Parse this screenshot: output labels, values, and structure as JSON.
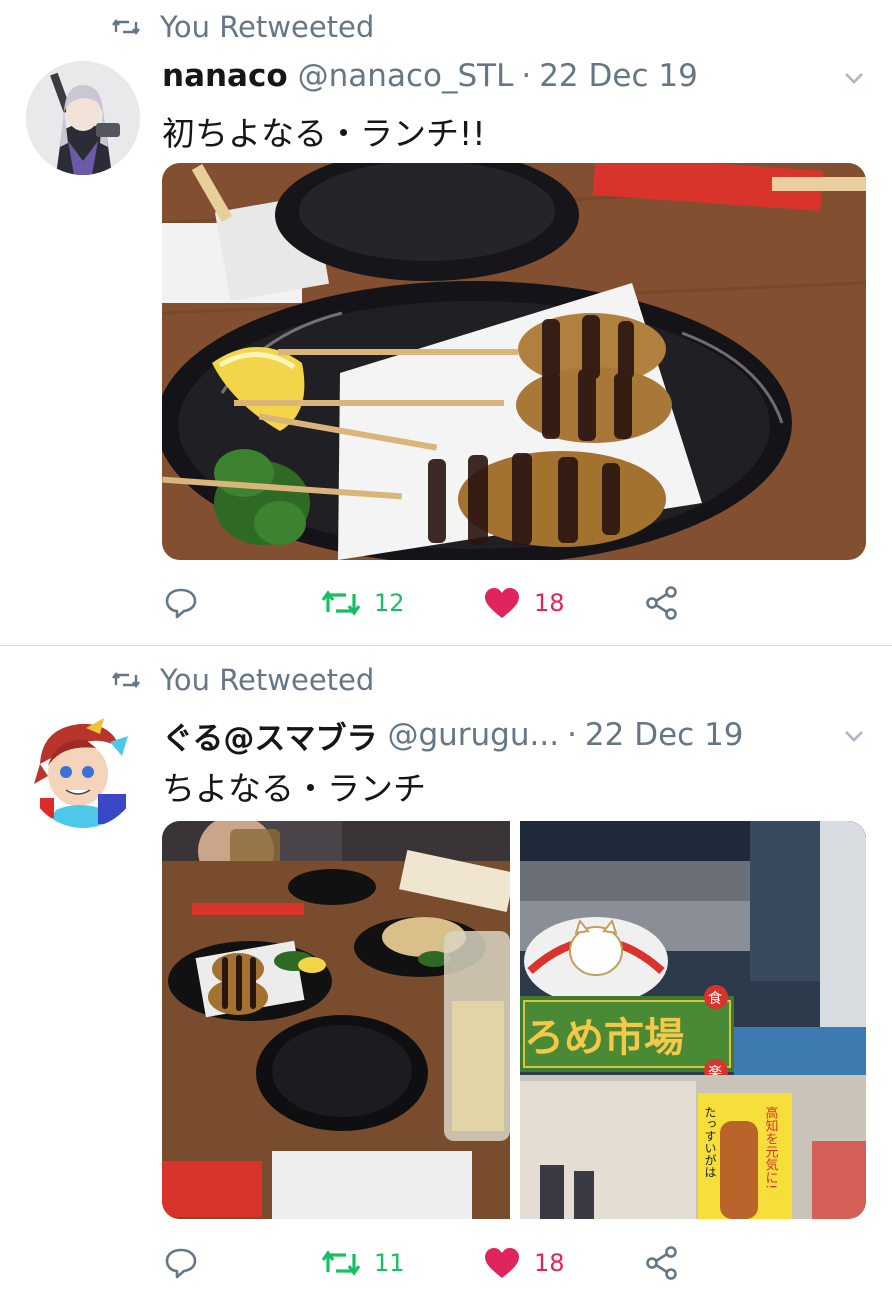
{
  "tweets": [
    {
      "retweet_context": "You Retweeted",
      "display_name": "nanaco",
      "handle": "@nanaco_STL",
      "date": "22 Dec 19",
      "text": "初ちよなる・ランチ!!",
      "retweet_count": "12",
      "like_count": "18",
      "retweeted": true,
      "liked": true
    },
    {
      "retweet_context": "You Retweeted",
      "display_name": "ぐる@スマブラ",
      "handle": "@gurugu...",
      "date": "22 Dec 19",
      "text": "ちよなる・ランチ",
      "retweet_count": "11",
      "like_count": "18",
      "retweeted": true,
      "liked": true,
      "photo_sign": "ろめ市場",
      "photo_sign_small": "食",
      "photo_sign_small_2": "楽",
      "photo_banner_1": "高知を元気に!",
      "photo_banner_2": "たっすいがは"
    }
  ],
  "icons": {
    "retweet_context": "retweet-icon",
    "reply": "reply-icon",
    "retweet": "retweet-icon",
    "like": "heart-icon",
    "share": "share-icon",
    "more": "chevron-down-icon"
  },
  "colors": {
    "retweet_active": "#17bf63",
    "like_active": "#e0245e",
    "secondary_text": "#657786",
    "primary_text": "#14171a",
    "divider": "#dadfe3"
  }
}
